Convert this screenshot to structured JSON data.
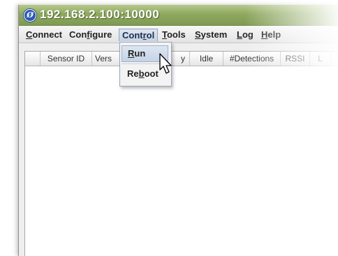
{
  "window": {
    "title": "192.168.2.100:10000",
    "app_icon_glyph": "Ø"
  },
  "menubar": {
    "connect": {
      "pre": "",
      "acc": "C",
      "post": "onnect"
    },
    "configure": {
      "pre": "Con",
      "acc": "f",
      "post": "igure"
    },
    "control": {
      "pre": "Cont",
      "acc": "r",
      "post": "ol"
    },
    "tools": {
      "pre": "",
      "acc": "T",
      "post": "ools"
    },
    "system": {
      "pre": "",
      "acc": "S",
      "post": "ystem"
    },
    "log": {
      "pre": "",
      "acc": "L",
      "post": "og"
    },
    "help": {
      "pre": "",
      "acc": "H",
      "post": "elp"
    }
  },
  "dropdown": {
    "run": {
      "pre": "",
      "acc": "R",
      "post": "un"
    },
    "reboot": {
      "pre": "Re",
      "acc": "b",
      "post": "oot"
    }
  },
  "table": {
    "columns": [
      "",
      "Sensor ID",
      "Vers",
      "y",
      "Idle",
      "#Detections",
      "RSSI",
      "L"
    ]
  },
  "colors": {
    "titlebar": "#8ea85f",
    "menu_active": "#c6d2e2",
    "accent": "#2d59b4"
  }
}
